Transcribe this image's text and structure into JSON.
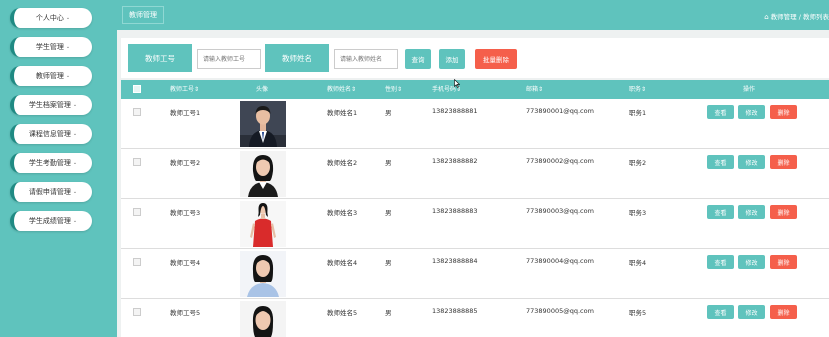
{
  "sidebar": {
    "items": [
      {
        "label": "个人中心"
      },
      {
        "label": "学生管理"
      },
      {
        "label": "教师管理"
      },
      {
        "label": "学生档案管理"
      },
      {
        "label": "课程信息管理"
      },
      {
        "label": "学生考勤管理"
      },
      {
        "label": "请假申请管理"
      },
      {
        "label": "学生成绩管理"
      }
    ]
  },
  "header": {
    "tab_label": "教师管理",
    "breadcrumb": "教师管理 / 教师列表"
  },
  "search": {
    "teacher_no_label": "教师工号",
    "teacher_no_placeholder": "请输入教师工号",
    "teacher_name_label": "教师姓名",
    "teacher_name_placeholder": "请输入教师姓名",
    "query_label": "查询",
    "add_label": "添加",
    "batch_delete_label": "批量删除"
  },
  "table": {
    "headers": {
      "teacher_no": "教师工号",
      "avatar": "头像",
      "teacher_name": "教师姓名",
      "gender": "性别",
      "phone": "手机号码",
      "email": "邮箱",
      "position": "职务",
      "actions": "操作"
    },
    "action_labels": {
      "view": "查看",
      "edit": "修改",
      "delete": "删除"
    },
    "rows": [
      {
        "teacher_no": "教师工号1",
        "teacher_name": "教师姓名1",
        "gender": "男",
        "phone": "13823888881",
        "email": "773890001@qq.com",
        "position": "职务1"
      },
      {
        "teacher_no": "教师工号2",
        "teacher_name": "教师姓名2",
        "gender": "男",
        "phone": "13823888882",
        "email": "773890002@qq.com",
        "position": "职务2"
      },
      {
        "teacher_no": "教师工号3",
        "teacher_name": "教师姓名3",
        "gender": "男",
        "phone": "13823888883",
        "email": "773890003@qq.com",
        "position": "职务3"
      },
      {
        "teacher_no": "教师工号4",
        "teacher_name": "教师姓名4",
        "gender": "男",
        "phone": "13823888884",
        "email": "773890004@qq.com",
        "position": "职务4"
      },
      {
        "teacher_no": "教师工号5",
        "teacher_name": "教师姓名5",
        "gender": "男",
        "phone": "13823888885",
        "email": "773890005@qq.com",
        "position": "职务5"
      }
    ]
  },
  "colors": {
    "accent": "#5fc3bd",
    "danger": "#f55f4b"
  }
}
